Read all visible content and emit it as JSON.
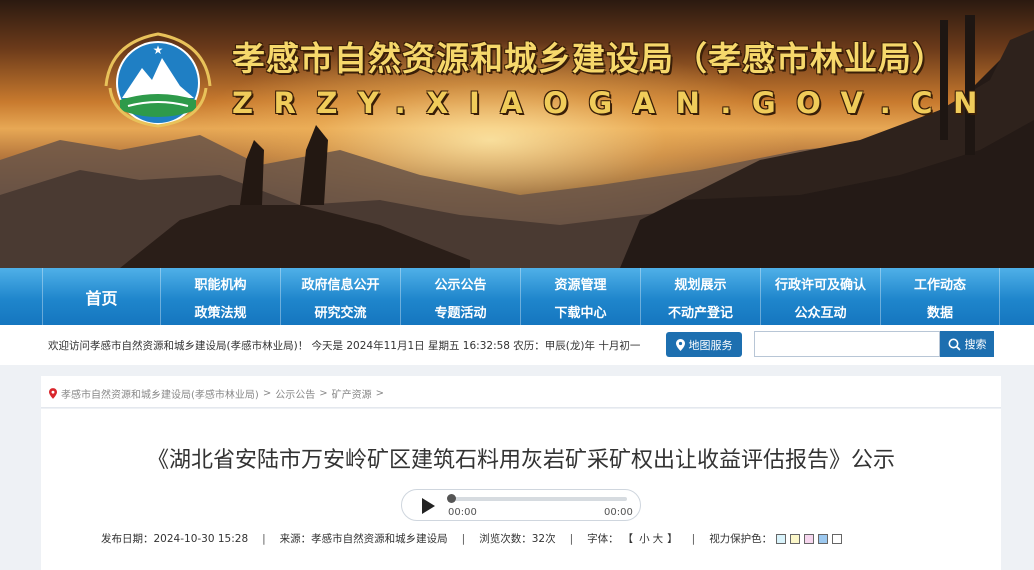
{
  "header": {
    "title": "孝感市自然资源和城乡建设局（孝感市林业局）",
    "domain": "ZRZY.XIAOGAN.GOV.CN"
  },
  "nav": {
    "home": "首页",
    "columns": [
      {
        "top": "职能机构",
        "bottom": "政策法规"
      },
      {
        "top": "政府信息公开",
        "bottom": "研究交流"
      },
      {
        "top": "公示公告",
        "bottom": "专题活动"
      },
      {
        "top": "资源管理",
        "bottom": "下载中心"
      },
      {
        "top": "规划展示",
        "bottom": "不动产登记"
      },
      {
        "top": "行政许可及确认",
        "bottom": "公众互动"
      },
      {
        "top": "工作动态",
        "bottom": "数据"
      }
    ]
  },
  "infobar": {
    "welcome": "欢迎访问孝感市自然资源和城乡建设局(孝感市林业局)！ 今天是 2024年11月1日 星期五 16:32:58      农历：甲辰(龙)年 十月初一",
    "map_button": "地图服务",
    "search_placeholder": "",
    "search_button": "搜索"
  },
  "breadcrumb": {
    "items": [
      "孝感市自然资源和城乡建设局(孝感市林业局)",
      "公示公告",
      "矿产资源"
    ],
    "separator": ">"
  },
  "article": {
    "title": "《湖北省安陆市万安岭矿区建筑石料用灰岩矿采矿权出让收益评估报告》公示",
    "audio": {
      "current": "00:00",
      "total": "00:00",
      "progress": 0
    },
    "meta": {
      "publish_label": "发布日期：",
      "publish_date": "2024-10-30 15:28",
      "source_label": "来源：",
      "source": "孝感市自然资源和城乡建设局",
      "views_label": "浏览次数：",
      "views": "32次",
      "font_label": "字体：",
      "font_open": "【",
      "font_small": "小",
      "font_large": "大",
      "font_close": "】",
      "eye_label": "视力保护色：",
      "sep": "|"
    },
    "eye_colors": [
      "#d9f3fb",
      "#fbf7c9",
      "#f6d6ee",
      "#9cc8ef",
      "#ffffff"
    ]
  }
}
